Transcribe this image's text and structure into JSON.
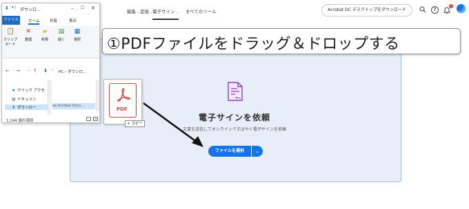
{
  "nav": {
    "edit": "編集",
    "convert": "変換",
    "esign": "電子サイン",
    "all_tools": "すべてのツール",
    "download_button": "Acrobat DC デスクトップをダウンロード",
    "notification_count": "1"
  },
  "dropzone": {
    "title": "電子サインを依頼",
    "subtitle": "文書を送信してオンラインですばやく電子サインを依頼",
    "select_button": "ファイルを選択"
  },
  "callout": {
    "text": "①PDFファイルをドラッグ＆ドロップする"
  },
  "explorer": {
    "title": "ダウンロ...",
    "tabs": [
      "ファイル",
      "ホーム",
      "共有",
      "表示"
    ],
    "ribbon": [
      "クリップボード",
      "整理",
      "新規",
      "開く",
      "選択"
    ],
    "address": "PC › ダウンロ...",
    "nav_items": [
      "クイック アクセ",
      "ドキュメン",
      "ダウンロー"
    ],
    "selected_file": "ee Acrobat Docu...",
    "status": "1,244 個の項目"
  },
  "drag": {
    "file_label": "PDF",
    "tooltip": "+ コピー"
  },
  "colors": {
    "accent": "#1473e6",
    "pdf_red": "#d8403c",
    "esign_purple": "#8e3bc4",
    "dropzone_bg": "#e8eef8"
  }
}
